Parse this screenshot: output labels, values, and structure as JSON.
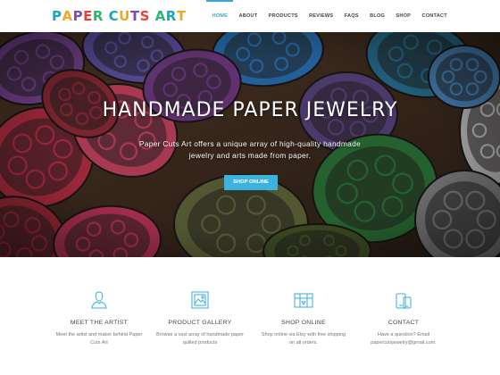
{
  "site": {
    "logo_letters": [
      "P",
      "A",
      "P",
      "E",
      "R",
      " ",
      "C",
      "U",
      "T",
      "S",
      " ",
      "A",
      "R",
      "T"
    ],
    "logo_colors": [
      "#1aa6b7",
      "#f5a623",
      "#7b4fb3",
      "#e8403c",
      "#2bb673"
    ]
  },
  "nav": {
    "items": [
      "HOME",
      "ABOUT",
      "PRODUCTS",
      "REVIEWS",
      "FAQS",
      "BLOG",
      "SHOP",
      "CONTACT"
    ],
    "active": "HOME",
    "accent": "#38a8d3"
  },
  "hero": {
    "title": "HANDMADE PAPER JEWELRY",
    "text": "Paper Cuts Art offers a unique array of high-quality handmade jewelry and arts made from paper.",
    "button": "SHOP ONLINE",
    "button_color": "#3cb3de"
  },
  "features": [
    {
      "icon": "person-icon",
      "title": "MEET THE ARTIST",
      "text": "Meet the artist and maker behind Paper Cuts Art"
    },
    {
      "icon": "gallery-icon",
      "title": "PRODUCT GALLERY",
      "text": "Browse a vast array of handmade paper quilled products"
    },
    {
      "icon": "shop-icon",
      "title": "SHOP ONLINE",
      "text": "Shop online via Etsy with free shipping on all orders."
    },
    {
      "icon": "mobile-icon",
      "title": "CONTACT",
      "text": "Have a question? Email papercutsjewelry@gmail.com."
    }
  ]
}
